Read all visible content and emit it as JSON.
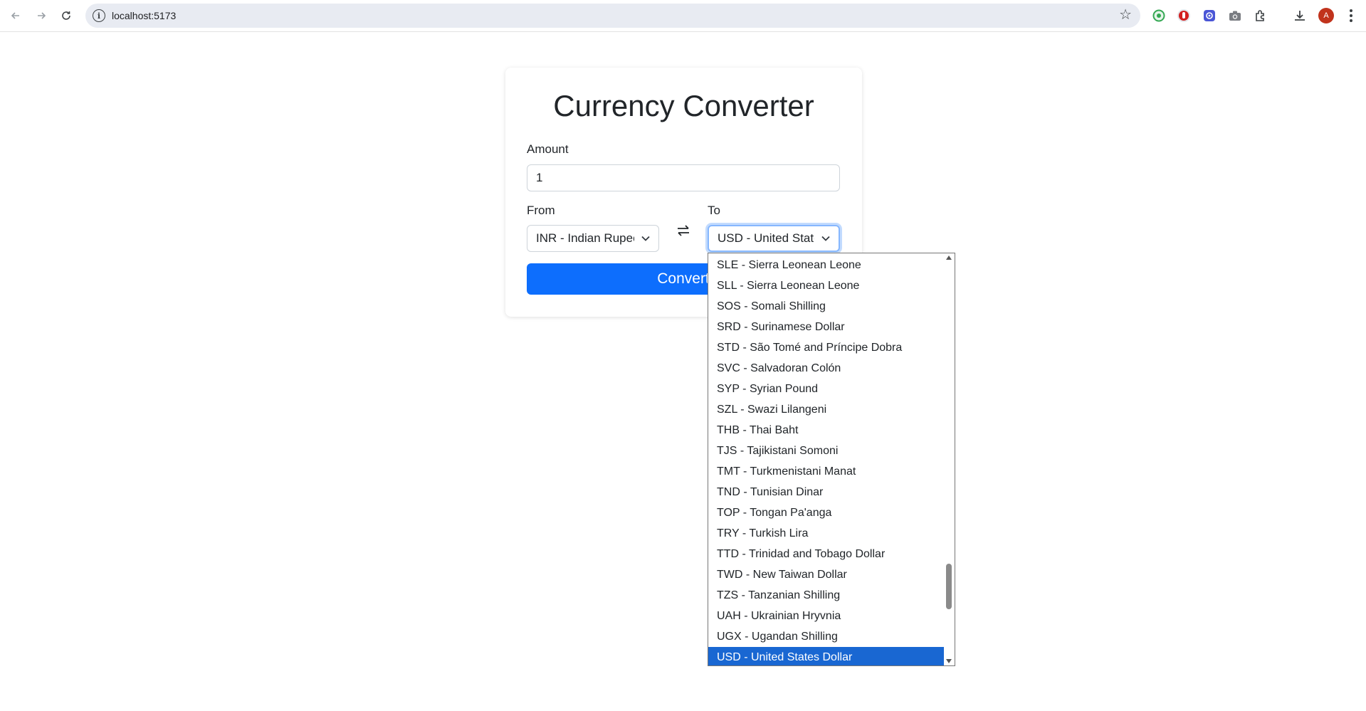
{
  "browser": {
    "url": "localhost:5173",
    "profile_initial": "A"
  },
  "app": {
    "title": "Currency Converter",
    "amount_label": "Amount",
    "amount_value": "1",
    "from_label": "From",
    "from_value": "INR - Indian Rupee",
    "to_label": "To",
    "to_value": "USD - United States Dollar",
    "convert_label": "Convert"
  },
  "dropdown": {
    "options": [
      "SLE - Sierra Leonean Leone",
      "SLL - Sierra Leonean Leone",
      "SOS - Somali Shilling",
      "SRD - Surinamese Dollar",
      "STD - São Tomé and Príncipe Dobra",
      "SVC - Salvadoran Colón",
      "SYP - Syrian Pound",
      "SZL - Swazi Lilangeni",
      "THB - Thai Baht",
      "TJS - Tajikistani Somoni",
      "TMT - Turkmenistani Manat",
      "TND - Tunisian Dinar",
      "TOP - Tongan Pa'anga",
      "TRY - Turkish Lira",
      "TTD - Trinidad and Tobago Dollar",
      "TWD - New Taiwan Dollar",
      "TZS - Tanzanian Shilling",
      "UAH - Ukrainian Hryvnia",
      "UGX - Ugandan Shilling",
      "USD - United States Dollar"
    ],
    "selected_index": 19
  },
  "icons": {
    "back": "arrow-left-icon",
    "forward": "arrow-right-icon",
    "reload": "reload-icon",
    "info": "info-icon",
    "bookmark": "star-icon",
    "swap": "swap-arrows-icon",
    "chevron": "chevron-down-icon"
  },
  "colors": {
    "primary": "#0d6efd",
    "selected_option": "#1967d2",
    "avatar": "#c1331c"
  }
}
